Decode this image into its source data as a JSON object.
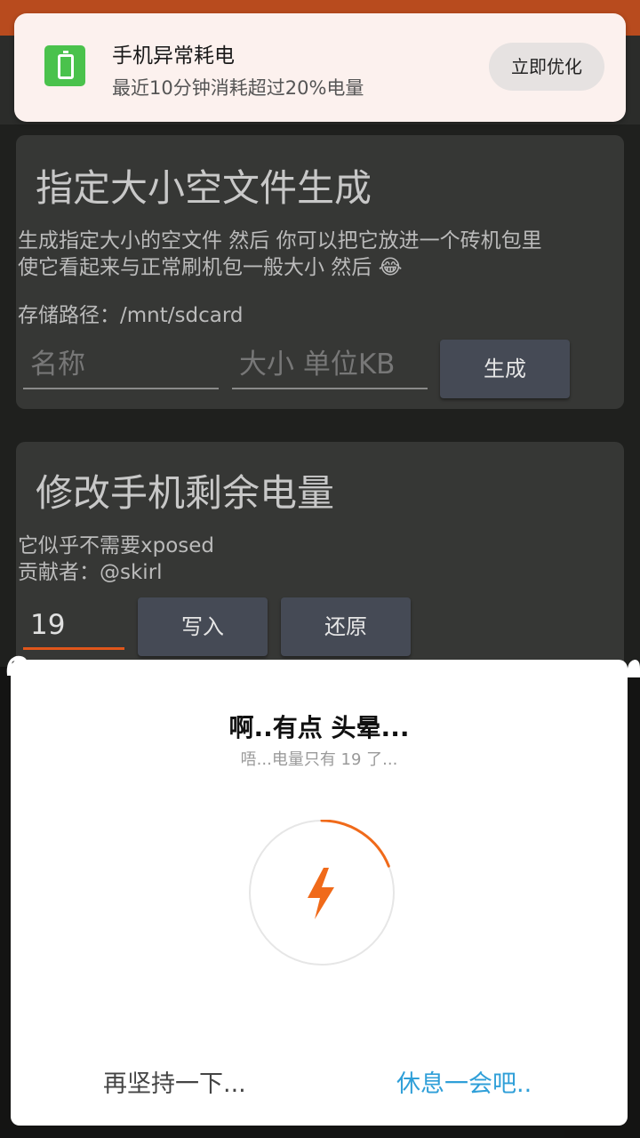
{
  "notification": {
    "icon": "battery-icon",
    "title": "手机异常耗电",
    "text": "最近10分钟消耗超过20%电量",
    "action": "立即优化"
  },
  "card_empty_file": {
    "title": "指定大小空文件生成",
    "desc_line1": "生成指定大小的空文件 然后 你可以把它放进一个砖机包里",
    "desc_line2": "使它看起来与正常刷机包一般大小 然后 😂",
    "storage_path": "存储路径：/mnt/sdcard",
    "name_placeholder": "名称",
    "size_placeholder": "大小 单位KB",
    "generate_label": "生成"
  },
  "card_battery": {
    "title": "修改手机剩余电量",
    "desc_line1": "它似乎不需要xposed",
    "desc_line2": "贡献者：@skirl",
    "battery_value": "19",
    "write_label": "写入",
    "restore_label": "还原"
  },
  "dialog": {
    "title": "啊..有点 头晕...",
    "subtitle": "唔...电量只有 19 了...",
    "icon": "lightning-icon",
    "battery_fraction": 0.19,
    "accent": "#f06a1a",
    "left_button": "再坚持一下...",
    "right_button": "休息一会吧.."
  },
  "colors": {
    "statusbar": "#b84b1e",
    "accent_orange": "#e0561b",
    "link_blue": "#2f9fd8"
  }
}
